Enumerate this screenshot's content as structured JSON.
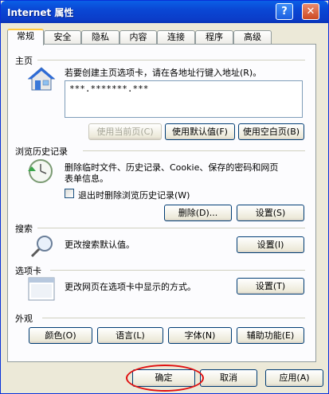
{
  "window": {
    "title": "Internet 属性",
    "help_label": "?",
    "close_label": "✕"
  },
  "tabs": [
    "常规",
    "安全",
    "隐私",
    "内容",
    "连接",
    "程序",
    "高级"
  ],
  "homepage": {
    "section_title": "主页",
    "description": "若要创建主页选项卡，请在各地址行键入地址(R)。",
    "url_value": "***.*******.***",
    "buttons": {
      "use_current": "使用当前页(C)",
      "use_default": "使用默认值(F)",
      "use_blank": "使用空白页(B)"
    }
  },
  "history": {
    "section_title": "浏览历史记录",
    "description_line1": "删除临时文件、历史记录、Cookie、保存的密码和网页",
    "description_line2": "表单信息。",
    "checkbox_label": "退出时删除浏览历史记录(W)",
    "delete_label": "删除(D)...",
    "settings_label": "设置(S)"
  },
  "search": {
    "section_title": "搜索",
    "description": "更改搜索默认值。",
    "settings_label": "设置(I)"
  },
  "tabbed": {
    "section_title": "选项卡",
    "description": "更改网页在选项卡中显示的方式。",
    "settings_label": "设置(T)"
  },
  "appearance": {
    "section_title": "外观",
    "buttons": {
      "colors": "颜色(O)",
      "languages": "语言(L)",
      "fonts": "字体(N)",
      "accessibility": "辅助功能(E)"
    }
  },
  "footer": {
    "ok": "确定",
    "cancel": "取消",
    "apply": "应用(A)"
  },
  "colors": {
    "titlebar": "#0a47d4",
    "highlight_circle": "#e01010"
  }
}
